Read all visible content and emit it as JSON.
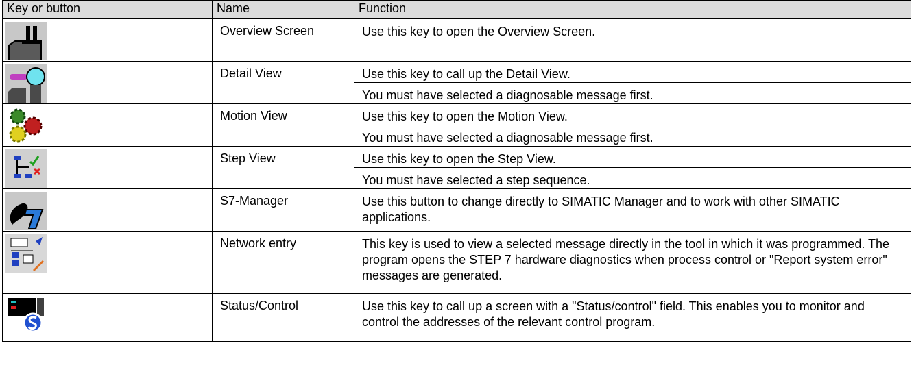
{
  "header": {
    "col1": "Key or button",
    "col2": "Name",
    "col3": "Function"
  },
  "rows": [
    {
      "icon": "plant-overview-icon",
      "name": "Overview Screen",
      "lines": [
        "Use this key to open the Overview Screen."
      ]
    },
    {
      "icon": "detail-view-icon",
      "name": "Detail View",
      "lines": [
        "Use this key to call up the Detail View.",
        "You must have selected a diagnosable message first."
      ]
    },
    {
      "icon": "motion-view-gears-icon",
      "name": "Motion View",
      "lines": [
        "Use this key to open the Motion View.",
        "You must have selected a diagnosable message first."
      ]
    },
    {
      "icon": "step-view-icon",
      "name": "Step View",
      "lines": [
        "Use this key to open the Step View.",
        "You must have selected a step sequence."
      ]
    },
    {
      "icon": "s7-manager-icon",
      "name": "S7-Manager",
      "lines": [
        "Use this button to change directly to SIMATIC Manager and to work with other SIMATIC applications."
      ]
    },
    {
      "icon": "network-entry-icon",
      "name": "Network entry",
      "lines": [
        "This key is used to view a selected message directly in the tool in which it was programmed. The program opens the STEP 7 hardware diagnostics when process control or \"Report system error\" messages are generated."
      ]
    },
    {
      "icon": "status-control-icon",
      "name": "Status/Control",
      "lines": [
        "Use this key to call up a screen with a \"Status/control\" field. This enables you to monitor and control the addresses of the relevant control program."
      ]
    }
  ]
}
